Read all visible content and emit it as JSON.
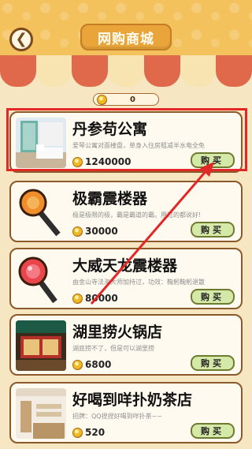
{
  "header": {
    "title": "网购商城",
    "back_icon": "chevron-left-icon"
  },
  "coins": {
    "icon": "coin-icon",
    "count": "0"
  },
  "items": [
    {
      "name": "丹参苟公寓",
      "desc": "爱琴公寓对面楼盘，单身入住房租减半水电全免",
      "price": "1240000",
      "buy": "购买"
    },
    {
      "name": "极霸震楼器",
      "desc": "极是极限的极，霸是霸道的霸。用过的都说好!",
      "price": "30000",
      "buy": "购买"
    },
    {
      "name": "大威天龙震楼器",
      "desc": "由金山寺法海大师加持过，功效：鞠躬鞠躬退散",
      "price": "80000",
      "buy": "购买"
    },
    {
      "name": "湖里捞火锅店",
      "desc": "湖底捞不了，但是可以湖里捞",
      "price": "6800",
      "buy": "购买"
    },
    {
      "name": "好喝到咩扑奶茶店",
      "desc": "招牌：QQ捏捏好喝到咩扑茶~~",
      "price": "520",
      "buy": "购买"
    }
  ],
  "colors": {
    "background": "#f6e6c2",
    "header": "#f3c25d",
    "awning_red": "#e0694b",
    "awning_cream": "#f7e4b1",
    "buy_button": "#d4e9a8",
    "highlight": "#e32727"
  }
}
